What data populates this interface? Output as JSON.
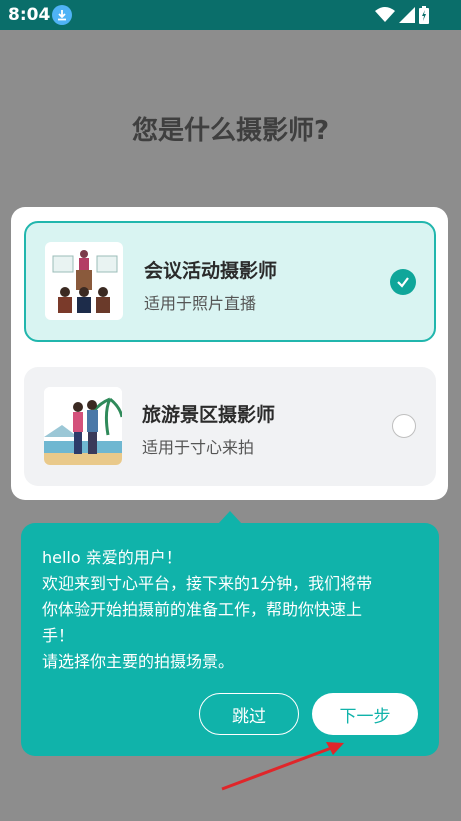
{
  "status_bar": {
    "time": "8:04",
    "icons": [
      "download-icon",
      "wifi-icon",
      "signal-icon",
      "battery-icon"
    ]
  },
  "page": {
    "title": "您是什么摄影师?"
  },
  "options": [
    {
      "title": "会议活动摄影师",
      "subtitle": "适用于照片直播",
      "selected": true,
      "icon": "conference-illustration"
    },
    {
      "title": "旅游景区摄影师",
      "subtitle": "适用于寸心来拍",
      "selected": false,
      "icon": "tourism-illustration"
    }
  ],
  "tooltip": {
    "lines": [
      "hello 亲爱的用户！",
      "欢迎来到寸心平台，接下来的1分钟，我们将带",
      "你体验开始拍摄前的准备工作，帮助你快速上",
      "手！",
      "请选择你主要的拍摄场景。"
    ],
    "skip_label": "跳过",
    "next_label": "下一步"
  },
  "colors": {
    "accent": "#10b3aa",
    "overlay": "#8d8d8d",
    "status_bar": "#0a6e6a",
    "annotation_arrow": "#e0262a"
  }
}
